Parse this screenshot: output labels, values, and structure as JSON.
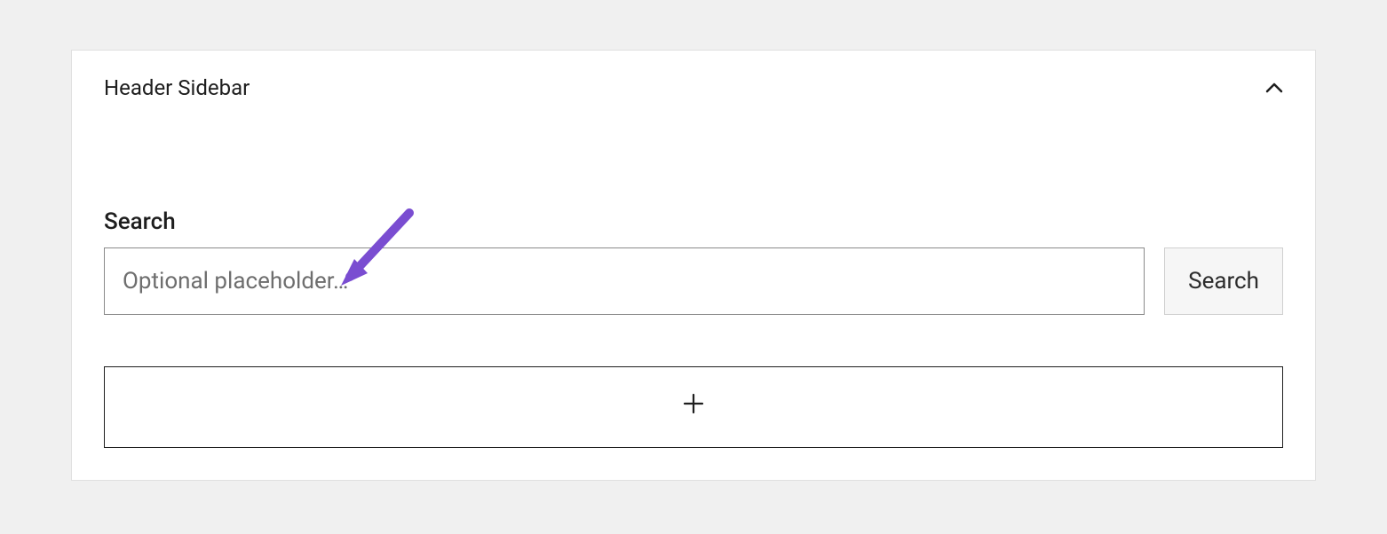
{
  "panel": {
    "title": "Header Sidebar"
  },
  "widgets": {
    "search": {
      "label": "Search",
      "placeholder": "Optional placeholder…",
      "button_label": "Search"
    }
  }
}
